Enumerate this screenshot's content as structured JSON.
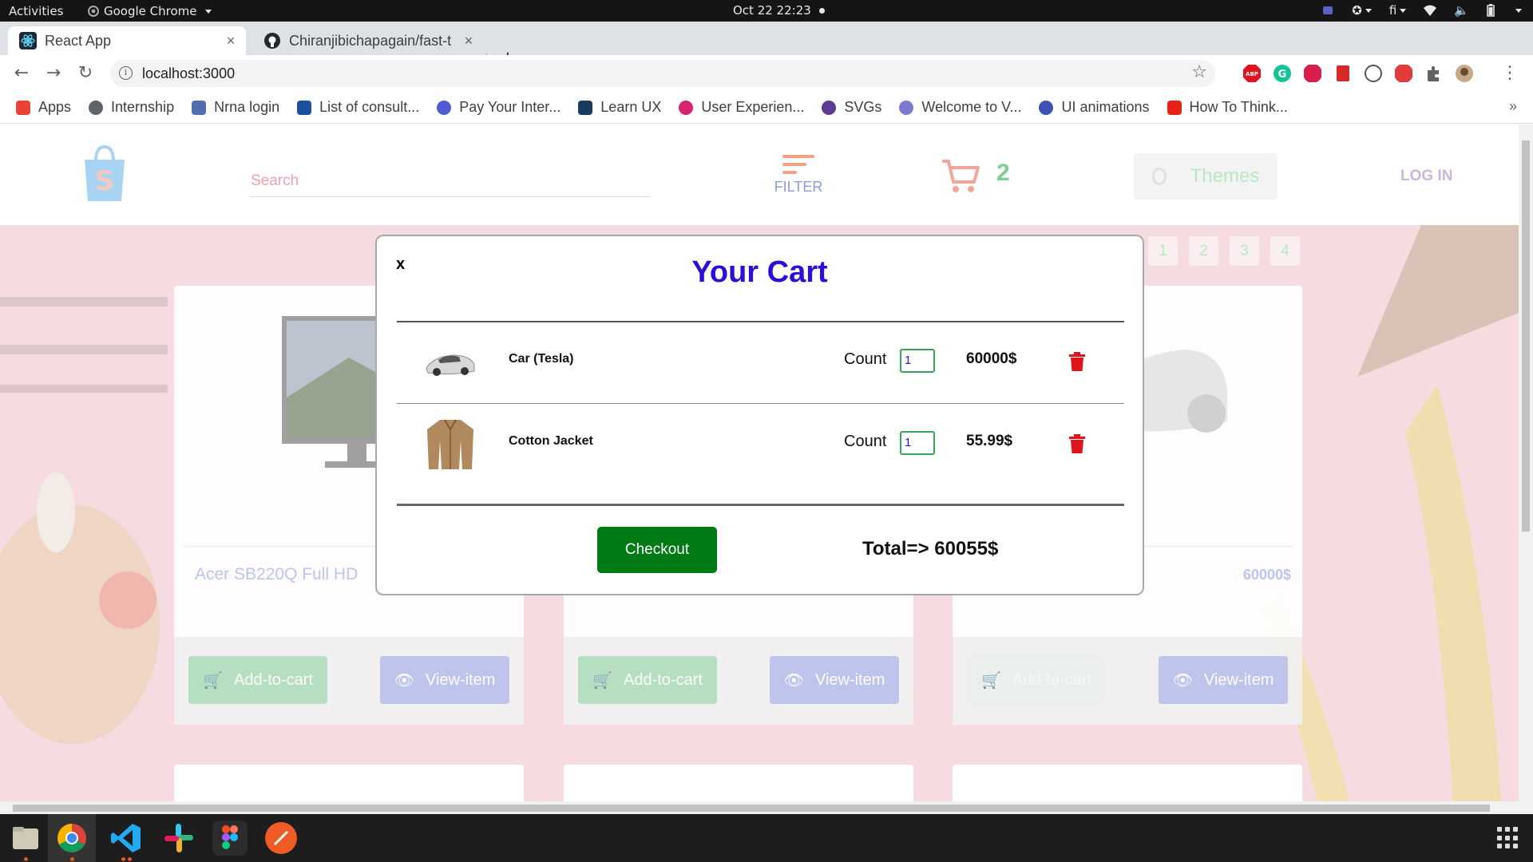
{
  "os_topbar": {
    "activities": "Activities",
    "app_name": "Google Chrome",
    "clock": "Oct 22  22:23",
    "keyboard_layout": "fi"
  },
  "browser": {
    "tabs": [
      {
        "title": "React App",
        "close": "×",
        "active": true
      },
      {
        "title": "Chiranjibichapagain/fast-t",
        "close": "×",
        "active": false
      }
    ],
    "new_tab": "+",
    "url": "localhost:3000",
    "info_glyph": "i",
    "bookmarks": [
      {
        "label": "Apps",
        "color": "#ea4335"
      },
      {
        "label": "Internship",
        "color": "#5f6368"
      },
      {
        "label": "Nrna login",
        "color": "#4f6fb0"
      },
      {
        "label": "List of consult...",
        "color": "#1c4f9c"
      },
      {
        "label": "Pay Your Inter...",
        "color": "#4f5bd5"
      },
      {
        "label": "Learn UX",
        "color": "#1a3a5e"
      },
      {
        "label": "User Experien...",
        "color": "#d6246e"
      },
      {
        "label": "SVGs",
        "color": "#5b3c91"
      },
      {
        "label": "Welcome to V...",
        "color": "#7b7bd0"
      },
      {
        "label": "UI animations",
        "color": "#3f51b5"
      },
      {
        "label": "How To Think...",
        "color": "#e62117"
      }
    ],
    "bookmarks_overflow": "»"
  },
  "app": {
    "search_placeholder": "Search",
    "filter_label": "FILTER",
    "cart_count": "2",
    "themes_label": "Themes",
    "login_label": "LOG IN",
    "pagination": [
      "1",
      "2",
      "3",
      "4"
    ],
    "cards": [
      {
        "name": "Acer SB220Q Full HD",
        "price": "",
        "add_label": "Add-to-cart",
        "view_label": "View-item"
      },
      {
        "name": "",
        "price": "",
        "add_label": "Add-to-cart",
        "view_label": "View-item"
      },
      {
        "name": "",
        "price": "60000$",
        "add_label": "Add-to-cart",
        "view_label": "View-item"
      }
    ]
  },
  "cart_modal": {
    "close_label": "x",
    "title": "Your Cart",
    "items": [
      {
        "name": "Car (Tesla)",
        "count_label": "Count",
        "quantity": "1",
        "price": "60000$"
      },
      {
        "name": "Cotton Jacket",
        "count_label": "Count",
        "quantity": "1",
        "price": "55.99$"
      }
    ],
    "checkout_label": "Checkout",
    "total": "Total=> 60055$"
  },
  "colors": {
    "modal_title": "#2b0ed8",
    "checkout_bg": "#007a14",
    "trash": "#e0141c",
    "add_to_cart": "#b1dfbf",
    "view_item": "#bac3ee"
  },
  "icons": {
    "dock": [
      "files-icon",
      "chrome-icon",
      "vscode-icon",
      "slack-icon",
      "figma-icon",
      "postman-icon",
      "app-grid-icon"
    ]
  }
}
